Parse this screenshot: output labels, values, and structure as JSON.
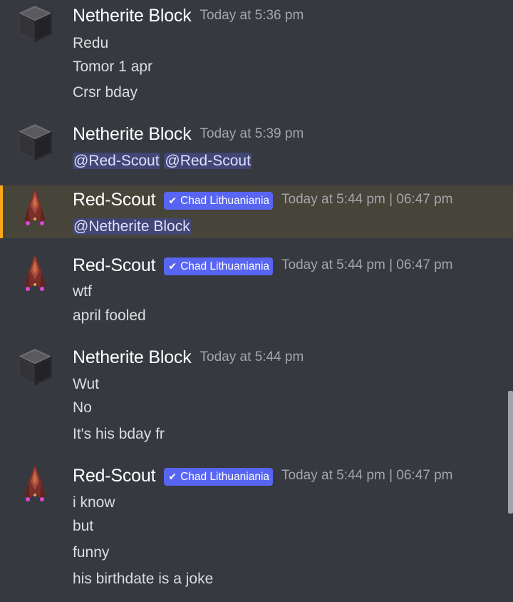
{
  "messages": [
    {
      "author": "Netherite Block",
      "timestamp": "Today at 5:36 pm",
      "lines": [
        "Redu",
        "Tomor 1 apr",
        "Crsr bday"
      ]
    },
    {
      "author": "Netherite Block",
      "timestamp": "Today at 5:39 pm",
      "mentions": [
        "@Red-Scout",
        "@Red-Scout"
      ]
    },
    {
      "author": "Red-Scout",
      "role": "Chad Lithuaniania",
      "timestamp": "Today at 5:44 pm | 06:47 pm",
      "mention": "@Netherite Block",
      "highlighted": true
    },
    {
      "author": "Red-Scout",
      "role": "Chad Lithuaniania",
      "timestamp": "Today at 5:44 pm | 06:47 pm",
      "lines": [
        "wtf",
        "april fooled"
      ]
    },
    {
      "author": "Netherite Block",
      "timestamp": "Today at 5:44 pm",
      "lines": [
        "Wut",
        "No",
        "It's his bday fr"
      ]
    },
    {
      "author": "Red-Scout",
      "role": "Chad Lithuaniania",
      "timestamp": "Today at 5:44 pm | 06:47 pm",
      "lines": [
        "i know",
        "but",
        "funny",
        "his birthdate is a joke"
      ]
    }
  ],
  "icons": {
    "netherite_avatar": "netherite-block-cube-avatar",
    "red_scout_avatar": "red-spaceship-avatar",
    "role_check": "checkmark-icon"
  },
  "colors": {
    "background": "#36393f",
    "highlight_bg": "#47443a",
    "highlight_bar": "#faa81a",
    "role_badge": "#5865f2",
    "mention_bg": "#414675"
  }
}
